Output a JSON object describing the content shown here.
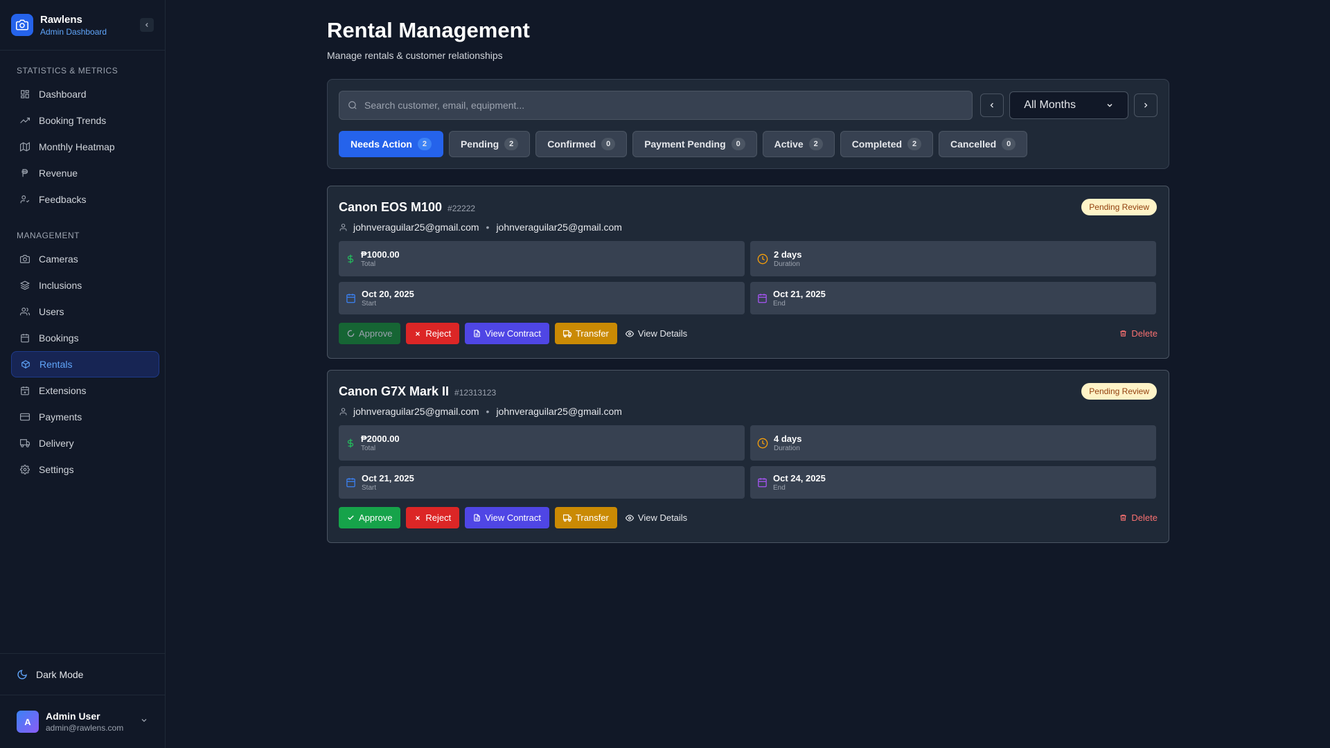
{
  "brand": {
    "title": "Rawlens",
    "subtitle": "Admin Dashboard"
  },
  "sidebar": {
    "sections": [
      {
        "label": "STATISTICS & METRICS",
        "items": [
          {
            "label": "Dashboard",
            "icon": "dashboard-icon"
          },
          {
            "label": "Booking Trends",
            "icon": "trending-up-icon"
          },
          {
            "label": "Monthly Heatmap",
            "icon": "map-icon"
          },
          {
            "label": "Revenue",
            "icon": "peso-icon"
          },
          {
            "label": "Feedbacks",
            "icon": "user-feedback-icon"
          }
        ]
      },
      {
        "label": "MANAGEMENT",
        "items": [
          {
            "label": "Cameras",
            "icon": "camera-icon"
          },
          {
            "label": "Inclusions",
            "icon": "layers-icon"
          },
          {
            "label": "Users",
            "icon": "users-icon"
          },
          {
            "label": "Bookings",
            "icon": "calendar-icon"
          },
          {
            "label": "Rentals",
            "icon": "package-icon",
            "active": true
          },
          {
            "label": "Extensions",
            "icon": "calendar-plus-icon"
          },
          {
            "label": "Payments",
            "icon": "credit-card-icon"
          },
          {
            "label": "Delivery",
            "icon": "truck-icon"
          },
          {
            "label": "Settings",
            "icon": "gear-icon"
          }
        ]
      }
    ],
    "dark_mode_label": "Dark Mode",
    "user": {
      "initial": "A",
      "name": "Admin User",
      "email": "admin@rawlens.com"
    }
  },
  "page": {
    "title": "Rental Management",
    "subtitle": "Manage rentals & customer relationships"
  },
  "filters": {
    "search_placeholder": "Search customer, email, equipment...",
    "month_selected": "All Months",
    "tabs": [
      {
        "label": "Needs Action",
        "count": "2",
        "active": true
      },
      {
        "label": "Pending",
        "count": "2"
      },
      {
        "label": "Confirmed",
        "count": "0"
      },
      {
        "label": "Payment Pending",
        "count": "0"
      },
      {
        "label": "Active",
        "count": "2"
      },
      {
        "label": "Completed",
        "count": "2"
      },
      {
        "label": "Cancelled",
        "count": "0"
      }
    ]
  },
  "rentals": [
    {
      "name": "Canon EOS M100",
      "id": "#22222",
      "status": "Pending Review",
      "customer": "johnveraguilar25@gmail.com",
      "email": "johnveraguilar25@gmail.com",
      "total": "₱1000.00",
      "total_label": "Total",
      "duration": "2 days",
      "duration_label": "Duration",
      "start": "Oct 20, 2025",
      "start_label": "Start",
      "end": "Oct 21, 2025",
      "end_label": "End",
      "approve_loading": true
    },
    {
      "name": "Canon G7X Mark II",
      "id": "#12313123",
      "status": "Pending Review",
      "customer": "johnveraguilar25@gmail.com",
      "email": "johnveraguilar25@gmail.com",
      "total": "₱2000.00",
      "total_label": "Total",
      "duration": "4 days",
      "duration_label": "Duration",
      "start": "Oct 21, 2025",
      "start_label": "Start",
      "end": "Oct 24, 2025",
      "end_label": "End",
      "approve_loading": false
    }
  ],
  "actions": {
    "approve": "Approve",
    "reject": "Reject",
    "view_contract": "View Contract",
    "transfer": "Transfer",
    "view_details": "View Details",
    "delete": "Delete"
  },
  "colors": {
    "accent": "#2563eb",
    "background": "#111827",
    "panel": "#1f2937",
    "pending_badge": "#fef3c7"
  }
}
